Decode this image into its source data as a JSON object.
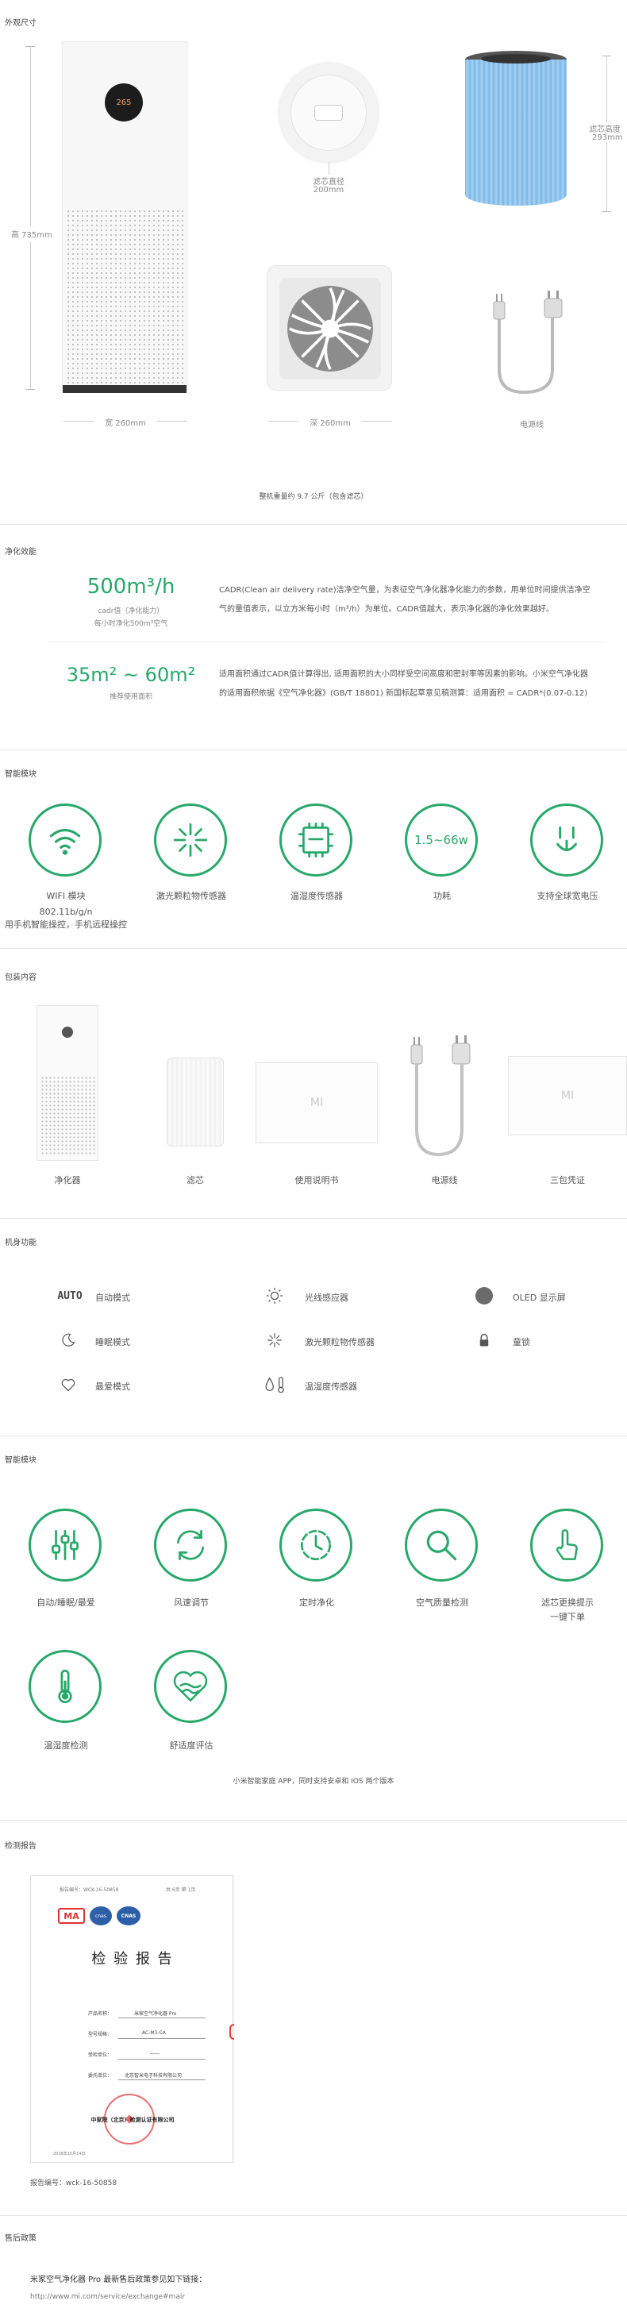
{
  "sections": {
    "dimensions": "外观尺寸",
    "purification": "净化效能",
    "smart_module_1": "智能模块",
    "package": "包装内容",
    "body_functions": "机身功能",
    "smart_module_2": "智能模块",
    "test_report": "检测报告",
    "after_sales": "售后政策"
  },
  "dimensions": {
    "height_label": "高 735mm",
    "width_label": "宽 260mm",
    "depth_label": "深 260mm",
    "filter_diameter_label": "滤芯直径",
    "filter_diameter_value": "200mm",
    "filter_height_label": "滤芯高度",
    "filter_height_value": "293mm",
    "power_cord_label": "电源线",
    "display_value": "265",
    "weight_note": "整机重量约 9.7 公斤（包含滤芯）"
  },
  "purification": {
    "cadr_value": "500m³/h",
    "cadr_sub1": "cadr值（净化能力）",
    "cadr_sub2": "每小时净化500m³空气",
    "cadr_desc": "CADR(Clean air delivery rate)洁净空气量，为表征空气净化器净化能力的参数，用单位时间提供洁净空气的量值表示，以立方米每小时（m³/h）为单位。CADR值越大，表示净化器的净化效果越好。",
    "area_value": "35m² ~ 60m²",
    "area_sub": "推荐使用面积",
    "area_desc": "适用面积通过CADR值计算得出, 适用面积的大小同样受空间高度和密封率等因素的影响。小米空气净化器的适用面积依据《空气净化器》(GB/T 18801) 新国标起草意见稿测算：适用面积 = CADR*(0.07-0.12)"
  },
  "smart_module_1": {
    "items": [
      {
        "label": "WIFI 模块",
        "sub1": "802.11b/g/n",
        "sub2": "用手机智能操控，手机远程操控"
      },
      {
        "label": "激光颗粒物传感器"
      },
      {
        "label": "温湿度传感器"
      },
      {
        "label": "功耗",
        "inner": "1.5~66w"
      },
      {
        "label": "支持全球宽电压"
      }
    ]
  },
  "package": {
    "items": [
      {
        "label": "净化器"
      },
      {
        "label": "滤芯"
      },
      {
        "label": "使用说明书",
        "logo": "MI"
      },
      {
        "label": "电源线"
      },
      {
        "label": "三包凭证",
        "logo": "MI"
      }
    ]
  },
  "body_functions": {
    "rows": [
      [
        {
          "icon": "AUTO",
          "label": "自动模式"
        },
        {
          "label": "光线感应器"
        },
        {
          "label": "OLED 显示屏"
        }
      ],
      [
        {
          "label": "睡眠模式"
        },
        {
          "label": "激光颗粒物传感器"
        },
        {
          "label": "童锁"
        }
      ],
      [
        {
          "label": "最爱模式"
        },
        {
          "label": "温湿度传感器"
        }
      ]
    ]
  },
  "smart_module_2": {
    "items": [
      {
        "label": "自动/睡眠/最爱"
      },
      {
        "label": "风速调节"
      },
      {
        "label": "定时净化"
      },
      {
        "label": "空气质量检测"
      },
      {
        "label": "滤芯更换提示",
        "label2": "一键下单"
      },
      {
        "label": "温湿度检测"
      },
      {
        "label": "舒适度评估"
      }
    ],
    "note": "小米智能家庭 APP，同时支持安卓和 IOS 两个版本"
  },
  "test_report": {
    "title": "检  验  报  告",
    "header_left": "报告编号：WCK-16-50858",
    "header_right": "共  6页  第  1页",
    "row_labels": [
      "产品名称：",
      "型号规格：",
      "受检单位：",
      "委托单位："
    ],
    "row_values": [
      "米家空气净化器 Pro",
      "AC-M3-CA",
      "——",
      "北京智米电子科技有限公司"
    ],
    "org_name": "中家院（北京）检测认证有限公司",
    "date": "2016年10月14日",
    "logos": [
      "MA",
      "cnas",
      "CNAS"
    ],
    "caption": "报告编号：wck-16-50858"
  },
  "after_sales": {
    "title": "米家空气净化器 Pro 最新售后政策参见如下链接：",
    "link": "http://www.mi.com/service/exchange#mair"
  },
  "colors": {
    "accent": "#27a86a",
    "text": "#333333",
    "muted": "#888888",
    "divider": "#e6e6e6"
  }
}
